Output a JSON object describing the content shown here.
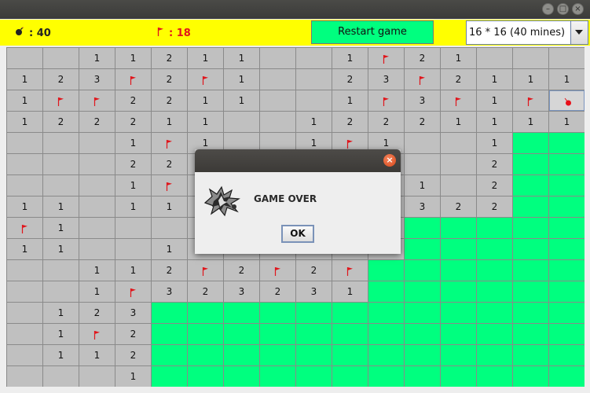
{
  "window": {
    "minimize_symbol": "–",
    "maximize_symbol": "□",
    "close_symbol": "×"
  },
  "status": {
    "mines_label": ": 40",
    "flags_label": ": 18"
  },
  "restart_label": "Restart game",
  "difficulty": {
    "selected": "16 * 16 (40 mines)"
  },
  "board": {
    "rows": [
      [
        "",
        "",
        "1",
        "1",
        "2",
        "1",
        "1",
        "",
        "",
        "1",
        "F",
        "2",
        "1",
        "",
        "",
        ""
      ],
      [
        "1",
        "2",
        "3",
        "F",
        "2",
        "F",
        "1",
        "",
        "",
        "2",
        "3",
        "F",
        "2",
        "1",
        "1",
        "1"
      ],
      [
        "1",
        "F",
        "F",
        "2",
        "2",
        "1",
        "1",
        "",
        "",
        "1",
        "F",
        "3",
        "F",
        "1",
        "F",
        "B"
      ],
      [
        "1",
        "2",
        "2",
        "2",
        "1",
        "1",
        "",
        "",
        "1",
        "2",
        "2",
        "2",
        "1",
        "1",
        "1",
        "1"
      ],
      [
        "",
        "",
        "",
        "1",
        "F",
        "1",
        "",
        "",
        "1",
        "F",
        "1",
        "",
        "",
        "1",
        "G",
        "G"
      ],
      [
        "",
        "",
        "",
        "2",
        "2",
        "",
        "",
        "",
        "",
        "",
        "",
        "",
        "",
        "2",
        "G",
        "G"
      ],
      [
        "",
        "",
        "",
        "1",
        "F",
        "",
        "",
        "",
        "",
        "",
        "",
        "1",
        "",
        "2",
        "G",
        "G"
      ],
      [
        "1",
        "1",
        "",
        "1",
        "1",
        "",
        "",
        "",
        "",
        "",
        "",
        "3",
        "2",
        "2",
        "G",
        "G"
      ],
      [
        "F",
        "1",
        "",
        "",
        "",
        "",
        "",
        "",
        "",
        "",
        "",
        "G",
        "G",
        "G",
        "G",
        "G"
      ],
      [
        "1",
        "1",
        "",
        "",
        "1",
        "",
        "",
        "",
        "",
        "",
        "",
        "G",
        "G",
        "G",
        "G",
        "G"
      ],
      [
        "",
        "",
        "1",
        "1",
        "2",
        "F",
        "2",
        "F",
        "2",
        "F",
        "G",
        "G",
        "G",
        "G",
        "G",
        "G"
      ],
      [
        "",
        "",
        "1",
        "F",
        "3",
        "2",
        "3",
        "2",
        "3",
        "1",
        "G",
        "G",
        "G",
        "G",
        "G",
        "G"
      ],
      [
        "",
        "1",
        "2",
        "3",
        "G",
        "G",
        "G",
        "G",
        "G",
        "G",
        "G",
        "G",
        "G",
        "G",
        "G",
        "G"
      ],
      [
        "",
        "1",
        "F",
        "2",
        "G",
        "G",
        "G",
        "G",
        "G",
        "G",
        "G",
        "G",
        "G",
        "G",
        "G",
        "G"
      ],
      [
        "",
        "1",
        "1",
        "2",
        "G",
        "G",
        "G",
        "G",
        "G",
        "G",
        "G",
        "G",
        "G",
        "G",
        "G",
        "G"
      ],
      [
        "",
        "",
        "",
        "1",
        "G",
        "G",
        "G",
        "G",
        "G",
        "G",
        "G",
        "G",
        "G",
        "G",
        "G",
        "G"
      ]
    ]
  },
  "dialog": {
    "close_symbol": "×",
    "message": "GAME OVER",
    "ok_label": "OK"
  },
  "colors": {
    "status_bar": "#ffff00",
    "restart_button": "#00ff7f",
    "unrevealed_cell": "#00ff7f",
    "revealed_cell": "#c0c0c0",
    "flag": "#e0151b"
  }
}
